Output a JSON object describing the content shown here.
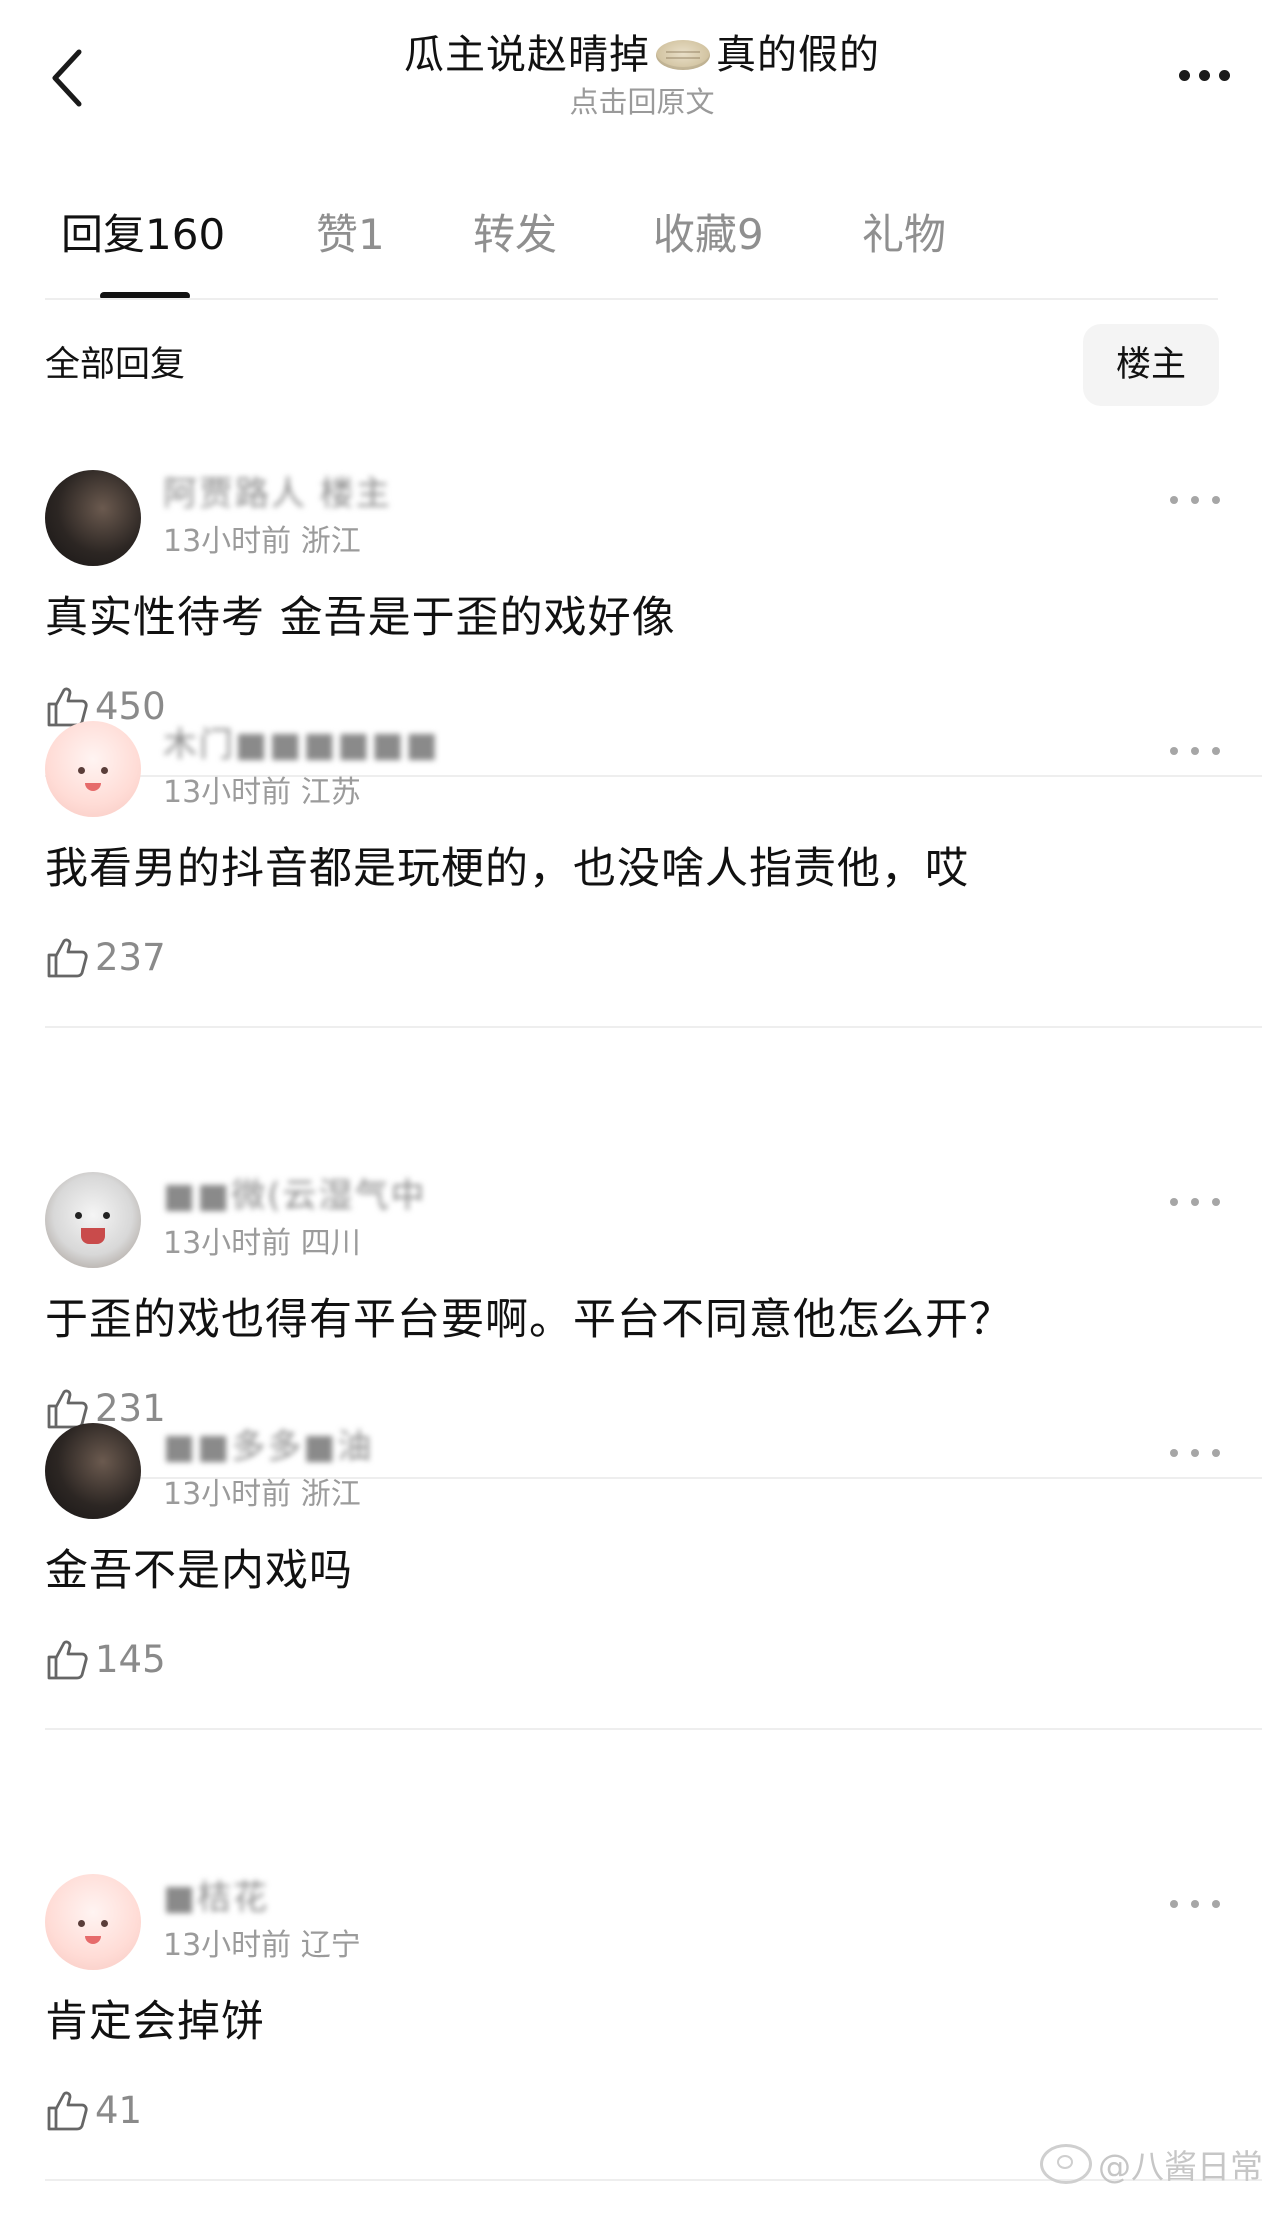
{
  "header": {
    "title_part1": "瓜主说赵晴掉",
    "title_part2": "真的假的",
    "title_icon": "pie-icon",
    "subtitle": "点击回原文",
    "back_icon": "chevron-left-icon",
    "more_icon": "more-horizontal-icon"
  },
  "tabs": [
    {
      "label": "回复",
      "count": "160",
      "active": true
    },
    {
      "label": "赞",
      "count": "1"
    },
    {
      "label": "转发",
      "count": ""
    },
    {
      "label": "收藏",
      "count": "9"
    },
    {
      "label": "礼物",
      "count": ""
    }
  ],
  "filter": {
    "label": "全部回复",
    "owner_button": "楼主"
  },
  "comments": [
    {
      "username": "阿贾路人 楼主",
      "time": "13小时前",
      "location": "浙江",
      "text": "真实性待考 金吾是于歪的戏好像",
      "likes": "450",
      "avatar": "dark"
    },
    {
      "username": "木门■■■■■■",
      "time": "13小时前",
      "location": "江苏",
      "text": "我看男的抖音都是玩梗的，也没啥人指责他，哎",
      "likes": "237",
      "avatar": "pink"
    },
    {
      "username": "■■微(云湿气中",
      "time": "13小时前",
      "location": "四川",
      "text": "于歪的戏也得有平台要啊。平台不同意他怎么开？",
      "likes": "231",
      "avatar": "cat"
    },
    {
      "username": "■■多多■油",
      "time": "13小时前",
      "location": "浙江",
      "text": "金吾不是内戏吗",
      "likes": "145",
      "avatar": "dark"
    },
    {
      "username": "■桔花",
      "time": "13小时前",
      "location": "辽宁",
      "text": "肯定会掉饼",
      "likes": "41",
      "avatar": "pink"
    }
  ],
  "watermark": "@八酱日常",
  "colors": {
    "text": "#111111",
    "muted": "#8a8a8a",
    "divider": "#eeeeee",
    "button_bg": "#f4f4f4"
  }
}
